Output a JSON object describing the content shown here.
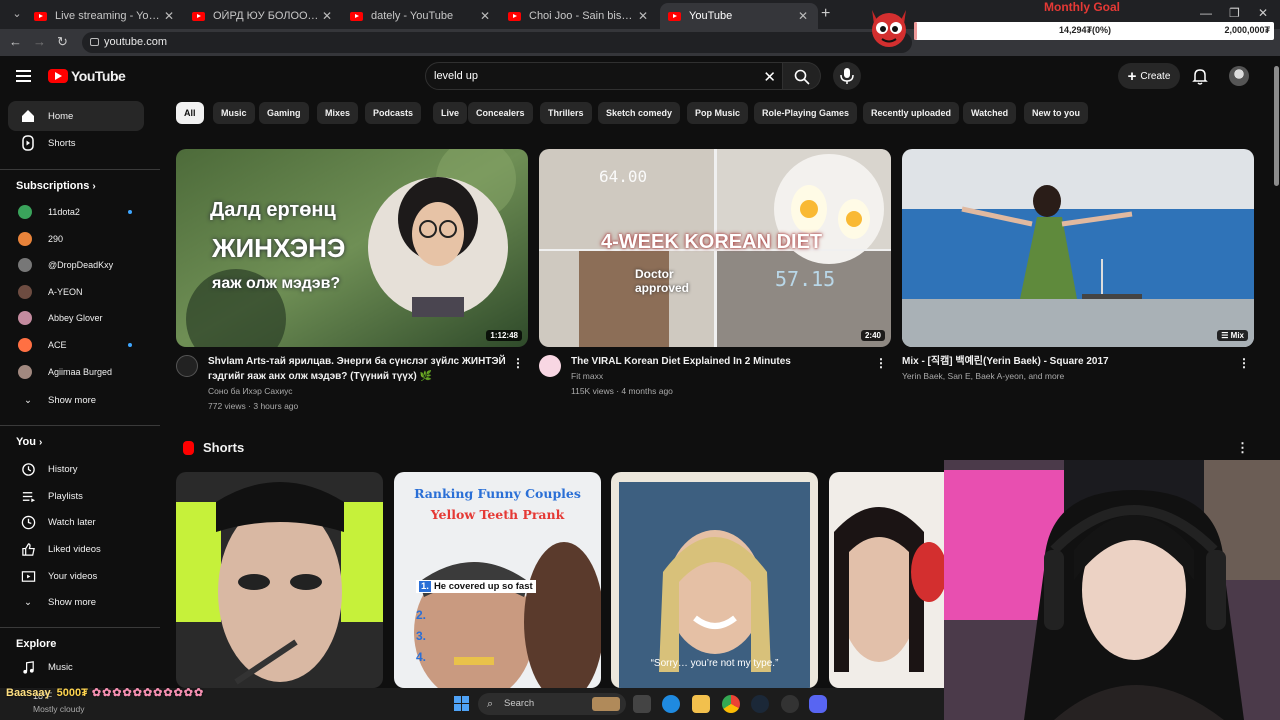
{
  "browser": {
    "tabs": [
      {
        "title": "Live streaming - YouTube Studio",
        "active": false
      },
      {
        "title": "ОЙРД ЮУ БОЛООД БАЙНА АЙ",
        "active": false
      },
      {
        "title": "dately - YouTube",
        "active": false
      },
      {
        "title": "Choi Joo - Sain bisx (Lyric Video)",
        "active": false
      },
      {
        "title": "YouTube",
        "active": true
      }
    ],
    "url": "youtube.com"
  },
  "overlay": {
    "goal_title": "Monthly Goal",
    "goal_current": "14,294₮(0%)",
    "goal_target": "2,000,000₮",
    "goal_progress": 0.007
  },
  "header": {
    "logo_text": "YouTube",
    "search_query": "leveld up",
    "create_label": "Create"
  },
  "sidebar": {
    "main": [
      {
        "label": "Home",
        "icon": "home-icon",
        "active": true
      },
      {
        "label": "Shorts",
        "icon": "shorts-icon",
        "active": false
      }
    ],
    "subscriptions_title": "Subscriptions",
    "subscriptions": [
      {
        "label": "11dota2",
        "color": "#3aa35b",
        "live": true
      },
      {
        "label": "290",
        "color": "#e8833a",
        "live": false
      },
      {
        "label": "@DropDeadKxy",
        "color": "#777777",
        "live": false
      },
      {
        "label": "A-YEON",
        "color": "#6d4c41",
        "live": false
      },
      {
        "label": "Abbey Glover",
        "color": "#c48b9f",
        "live": false
      },
      {
        "label": "ACE",
        "color": "#ff7043",
        "live": true
      },
      {
        "label": "Agiimaa Burged",
        "color": "#a1887f",
        "live": false
      }
    ],
    "show_more_1": "Show more",
    "you_title": "You",
    "you": [
      {
        "label": "History",
        "icon": "history-icon"
      },
      {
        "label": "Playlists",
        "icon": "playlists-icon"
      },
      {
        "label": "Watch later",
        "icon": "watch-later-icon"
      },
      {
        "label": "Liked videos",
        "icon": "like-icon"
      },
      {
        "label": "Your videos",
        "icon": "your-videos-icon"
      }
    ],
    "show_more_2": "Show more",
    "explore_title": "Explore",
    "explore": [
      {
        "label": "Music",
        "icon": "music-icon"
      }
    ]
  },
  "chips": [
    "All",
    "Music",
    "Gaming",
    "Mixes",
    "Podcasts",
    "Live",
    "Concealers",
    "Thrillers",
    "Sketch comedy",
    "Pop Music",
    "Role-Playing Games",
    "Recently uploaded",
    "Watched",
    "New to you"
  ],
  "videos": [
    {
      "title": "Shvlam Arts-тай ярилцав. Энерги ба сүнслэг зүйлс ЖИНТЭЙ гэдгийг яаж анх олж мэдэв? (Түүний түүх) 🌿",
      "channel": "Соно ба Ихэр Сахиус",
      "stats": "772 views · 3 hours ago",
      "duration": "1:12:48",
      "thumb_text_1": "Далд ертөнц",
      "thumb_text_2": "ЖИНХЭНЭ",
      "thumb_text_3": "яаж олж мэдэв?"
    },
    {
      "title": "The VIRAL Korean Diet Explained In 2 Minutes",
      "channel": "Fit maxx",
      "stats": "115K views · 4 months ago",
      "duration": "2:40",
      "thumb_text_1": "4-WEEK KOREAN DIET",
      "thumb_text_2": "Doctor approved",
      "thumb_text_3": "64.00",
      "thumb_text_4": "57.15"
    },
    {
      "title": "Mix - [직캠] 백예린(Yerin Baek) - Square 2017",
      "channel": "Yerin Baek, San E, Baek A-yeon, and more",
      "stats": "",
      "duration": "Mix"
    }
  ],
  "shorts": {
    "title": "Shorts",
    "items": [
      {
        "caption": ""
      },
      {
        "caption_1": "Ranking Funny Couples",
        "caption_2": "Yellow Teeth Prank",
        "caption_3": "He covered up so fast"
      },
      {
        "caption": "“Sorry… you’re not my type.”"
      },
      {
        "caption": ""
      }
    ]
  },
  "taskbar": {
    "weather_temp": "18°F",
    "weather_desc": "Mostly cloudy",
    "search_placeholder": "Search"
  },
  "donation": {
    "name": "Baasaay",
    "amount": "5000₮",
    "stars": "✿✿✿✿✿✿✿✿✿✿✿"
  }
}
